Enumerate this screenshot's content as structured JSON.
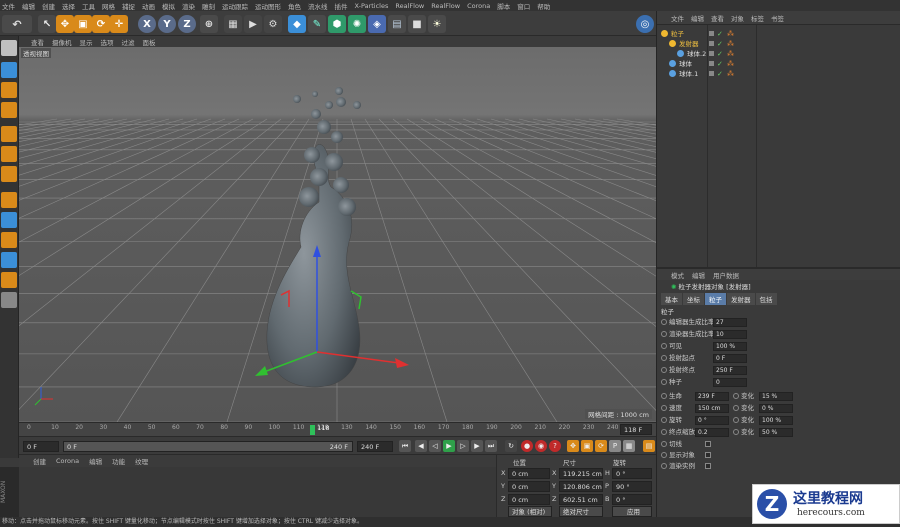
{
  "menu": [
    "文件",
    "编辑",
    "创建",
    "选择",
    "工具",
    "网格",
    "捕捉",
    "动画",
    "模拟",
    "渲染",
    "雕刻",
    "运动跟踪",
    "运动图形",
    "角色",
    "流水线",
    "插件",
    "X-Particles",
    "RealFlow",
    "RealFlow",
    "Corona",
    "脚本",
    "窗口",
    "帮助"
  ],
  "toolbar": {
    "axis_x": "X",
    "axis_y": "Y",
    "axis_z": "Z"
  },
  "viewport": {
    "menu": [
      "查看",
      "摄像机",
      "显示",
      "选项",
      "过滤",
      "面板"
    ],
    "label": "透视视图",
    "grid_info": "网格间距 : 1000 cm"
  },
  "timeline": {
    "ticks": [
      "0",
      "10",
      "20",
      "30",
      "40",
      "50",
      "60",
      "70",
      "80",
      "90",
      "100",
      "110",
      "120",
      "130",
      "140",
      "150",
      "160",
      "170",
      "180",
      "190",
      "200",
      "210",
      "220",
      "230",
      "240"
    ],
    "current_frame": "118",
    "frame_box": "118 F"
  },
  "transport": {
    "start": "0 F",
    "slider_start": "0 F",
    "slider_end": "240 F",
    "end": "240 F"
  },
  "material": {
    "menu": [
      "创建",
      "Corona",
      "编辑",
      "功能",
      "纹理"
    ]
  },
  "coords": {
    "headers": [
      "位置",
      "尺寸",
      "旋转"
    ],
    "rows": [
      {
        "axis": "X",
        "pos": "0 cm",
        "size": "119.215 cm",
        "rot_label": "H",
        "rot": "0 °"
      },
      {
        "axis": "Y",
        "pos": "0 cm",
        "size": "120.806 cm",
        "rot_label": "P",
        "rot": "90 °"
      },
      {
        "axis": "Z",
        "pos": "0 cm",
        "size": "602.51 cm",
        "rot_label": "B",
        "rot": "0 °"
      }
    ],
    "mode": "对象 (相对)",
    "size_mode": "绝对尺寸",
    "apply": "应用"
  },
  "objects": {
    "menu": [
      "文件",
      "编辑",
      "查看",
      "对象",
      "标签",
      "书签"
    ],
    "items": [
      {
        "name": "粒子",
        "indent": 0,
        "color": "#f0b830"
      },
      {
        "name": "发射器",
        "indent": 1,
        "color": "#f0b830"
      },
      {
        "name": "球体.2",
        "indent": 2,
        "color": "#5aa0e0"
      },
      {
        "name": "球体",
        "indent": 1,
        "color": "#5aa0e0"
      },
      {
        "name": "球体.1",
        "indent": 1,
        "color": "#5aa0e0"
      }
    ]
  },
  "attributes": {
    "menu": [
      "模式",
      "编辑",
      "用户数据"
    ],
    "title": "粒子发射器对象 [发射器]",
    "tabs": [
      "基本",
      "坐标",
      "粒子",
      "发射器",
      "包括"
    ],
    "active_tab": 2,
    "section": "粒子",
    "rows": [
      {
        "label": "编辑器生成比率",
        "value": "27"
      },
      {
        "label": "渲染器生成比率",
        "value": "10"
      },
      {
        "label": "可见",
        "value": "100 %"
      },
      {
        "label": "投射起点",
        "value": "0 F"
      },
      {
        "label": "投射终点",
        "value": "250 F"
      },
      {
        "label": "种子",
        "value": "0"
      }
    ],
    "pairs": [
      {
        "label": "生命",
        "value": "239 F",
        "vlabel": "变化",
        "vvalue": "15 %"
      },
      {
        "label": "速度",
        "value": "150 cm",
        "vlabel": "变化",
        "vvalue": "0 %"
      },
      {
        "label": "旋转",
        "value": "0 °",
        "vlabel": "变化",
        "vvalue": "100 %"
      },
      {
        "label": "终点缩放",
        "value": "0.2",
        "vlabel": "变化",
        "vvalue": "50 %"
      }
    ],
    "checks": [
      "切线",
      "显示对象",
      "渲染实例"
    ]
  },
  "status": "移动：点击并拖动鼠标移动元素。按住 SHIFT 键量化移动；节点编辑模式时按住 SHIFT 键增加选择对象；按住 CTRL 键减少选择对象。",
  "watermark": {
    "title": "这里教程网",
    "url": "herecours.com"
  },
  "colors": {
    "accent": "#5a7ca8",
    "axis_x": "#e03030",
    "axis_y": "#30c030",
    "axis_z": "#3050e0"
  }
}
